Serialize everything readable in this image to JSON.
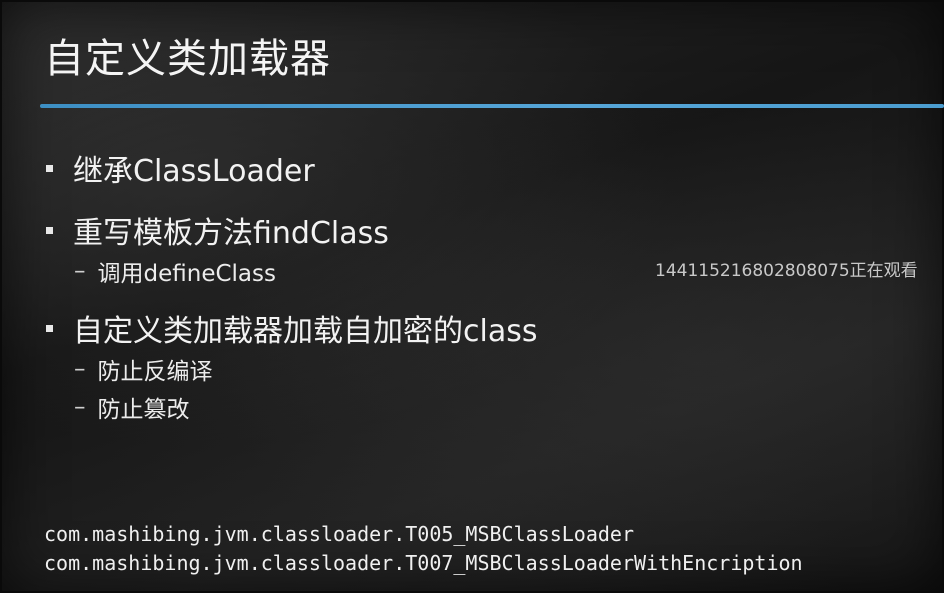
{
  "slide": {
    "title": "自定义类加载器",
    "bullets": [
      {
        "text": "继承ClassLoader",
        "subs": []
      },
      {
        "text": "重写模板方法findClass",
        "subs": [
          "调用defineClass"
        ]
      },
      {
        "text": "自定义类加载器加载自加密的class",
        "subs": [
          "防止反编译",
          "防止篡改"
        ]
      }
    ],
    "sub_dash": "–",
    "code_lines": [
      "com.mashibing.jvm.classloader.T005_MSBClassLoader",
      "com.mashibing.jvm.classloader.T007_MSBClassLoaderWithEncription"
    ]
  },
  "overlay": {
    "viewer_text": "1441152168028080​75正在观看"
  },
  "colors": {
    "accent_rule": "#4b9dd0",
    "background": "#1e1e1e",
    "text": "#f2f2f2"
  }
}
